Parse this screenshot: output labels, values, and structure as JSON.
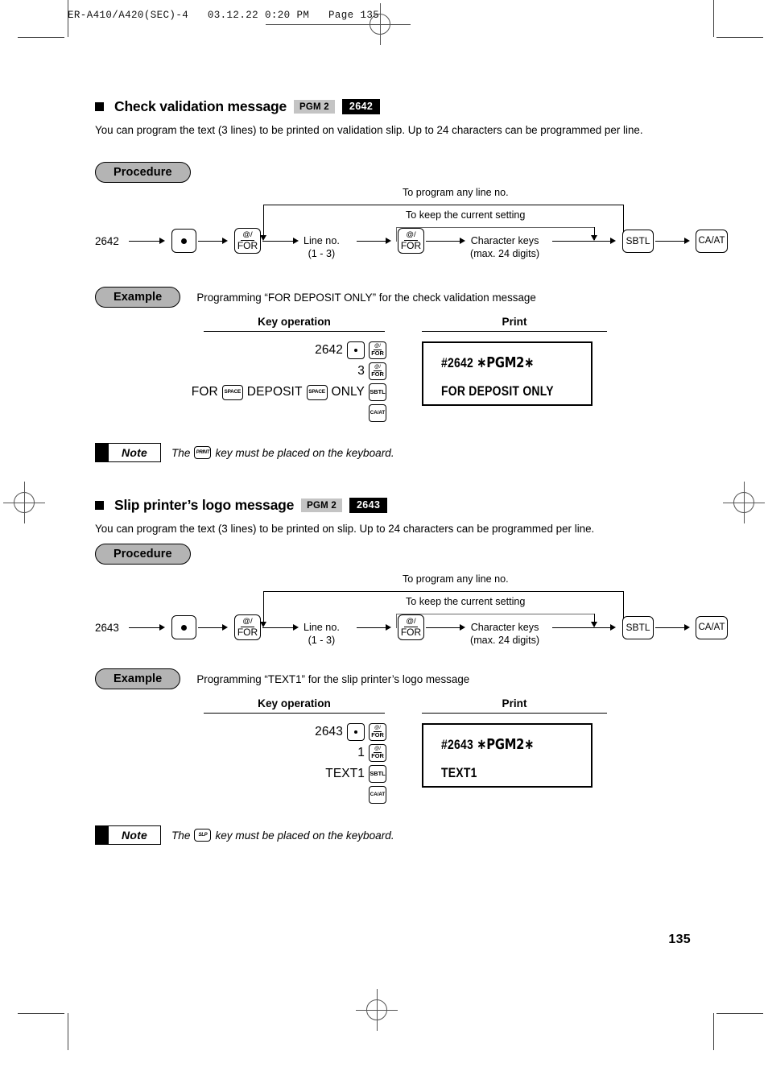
{
  "print_slug": "ER-A410/A420(SEC)-4   03.12.22 0:20 PM   Page 135",
  "page_number": "135",
  "colors": {
    "badge_pgm_bg": "#c4c4c4",
    "badge_code_bg": "#000000",
    "pill_bg": "#b4b4b4",
    "rule": "#000000"
  },
  "labels": {
    "procedure": "Procedure",
    "example": "Example",
    "key_operation": "Key operation",
    "print": "Print",
    "note": "Note",
    "to_program_any_line": "To program any line no.",
    "to_keep_current": "To keep the current setting",
    "line_no": "Line no.",
    "line_no_range": "(1 - 3)",
    "character_keys": "Character keys",
    "character_keys_max": "(max. 24 digits)"
  },
  "keys": {
    "decimal_point": ".",
    "at_for_top": "@/",
    "at_for_bottom": "FOR",
    "sbtl": "SBTL",
    "ca_at": "CA/AT",
    "space": "SPACE",
    "print": "PRINT",
    "slp": "SLP"
  },
  "sections": [
    {
      "title": "Check validation message",
      "badge_pgm": "PGM 2",
      "badge_code": "2642",
      "description": "You can program the text (3 lines) to be printed on validation slip. Up to 24 characters can be programmed per line.",
      "flow_start": "2642",
      "example_caption": "Programming “FOR DEPOSIT ONLY” for the check validation message",
      "key_rows": [
        {
          "text": "2642",
          "keys": [
            "dot",
            "for"
          ]
        },
        {
          "text": "3",
          "keys": [
            "for"
          ]
        },
        {
          "text": "FOR",
          "text2": "DEPOSIT",
          "text3": "ONLY",
          "keys": [
            "sbtl"
          ]
        },
        {
          "text": "",
          "keys": [
            "caat"
          ]
        }
      ],
      "print_line1_code": "#2642",
      "print_line1_mode": "∗PGM2∗",
      "print_line2": "FOR DEPOSIT ONLY",
      "note_text_before": "The",
      "note_key": "PRINT",
      "note_text_after": "key must be placed on the keyboard."
    },
    {
      "title": "Slip printer’s logo message",
      "badge_pgm": "PGM 2",
      "badge_code": "2643",
      "description": "You can program the text (3 lines) to be printed on slip. Up to 24 characters can be programmed per line.",
      "flow_start": "2643",
      "example_caption": "Programming “TEXT1” for the slip printer’s logo message",
      "key_rows": [
        {
          "text": "2643",
          "keys": [
            "dot",
            "for"
          ]
        },
        {
          "text": "1",
          "keys": [
            "for"
          ]
        },
        {
          "text": "TEXT1",
          "keys": [
            "sbtl"
          ]
        },
        {
          "text": "",
          "keys": [
            "caat"
          ]
        }
      ],
      "print_line1_code": "#2643",
      "print_line1_mode": "∗PGM2∗",
      "print_line2": "TEXT1",
      "note_text_before": "The",
      "note_key": "SLP",
      "note_text_after": "key must be placed on the keyboard."
    }
  ]
}
